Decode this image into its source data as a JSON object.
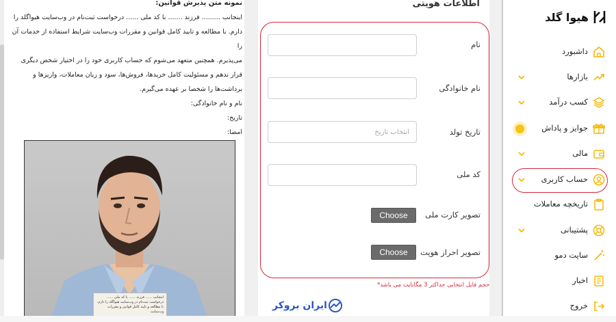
{
  "sample": {
    "title": "نمونه متن پذیرش قوانین:",
    "line1": "اینجانب ......... فرزند ....... با کد ملی ...... درخواست ثبت‌نام در وب‌سایت هیواگلد را",
    "line2": "دارم. با مطالعه و تایید کامل قوانین و مقررات وب‌سایت شرایط استفاده از خدمات آن را",
    "line3": "می‌پذیرم. همچنین متعهد می‌شوم که حساب کاربری خود را در اختیار شخص دیگری",
    "line4": "قرار ندهم و مسئولیت کامل خریدها، فروش‌ها، سود و زیان معاملات، واریزها و",
    "line5": "برداشت‌ها را شخصا بر عهده می‌گیرم.",
    "name_line": "نام و نام خانوادگی:",
    "date_line": "تاریخ:",
    "sign_line": "امضا:",
    "photo_note": "اینجانب ...... فرزند ...... با کد ملی ...... درخواست ثبت‌نام در وب‌سایت هیواگلد را دارم. با مطالعه و تایید کامل قوانین و مقررات وب‌سایت"
  },
  "form": {
    "heading": "اطلاعات هویتی",
    "first_name_label": "نام",
    "first_name_value": "",
    "last_name_label": "نام خانوادگی",
    "last_name_value": "",
    "birth_date_label": "تاریخ تولد",
    "birth_date_placeholder": "انتخاب تاریخ",
    "national_code_label": "کد ملی",
    "national_code_value": "",
    "id_card_label": "تصویر کارت ملی",
    "identity_photo_label": "تصویر احراز هویت",
    "choose_file_label": "Choose File",
    "file_size_note": "*حجم فایل انتخابی حداکثر 3 مگابایت می باشد*"
  },
  "brand": {
    "name": "ایران بروکر"
  },
  "app": {
    "name": "هیوا گلد"
  },
  "sidebar": {
    "items": [
      {
        "label": "داشبورد",
        "icon": "home-icon",
        "has_chevron": false
      },
      {
        "label": "بازارها",
        "icon": "trend-icon",
        "has_chevron": true
      },
      {
        "label": "کسب درآمد",
        "icon": "layers-icon",
        "has_chevron": true
      },
      {
        "label": "جوایز و پاداش",
        "icon": "gift-icon",
        "has_chevron": false
      },
      {
        "label": "مالی",
        "icon": "wallet-icon",
        "has_chevron": true
      },
      {
        "label": "حساب کاربری",
        "icon": "user-circle-icon",
        "has_chevron": true
      },
      {
        "label": "تاریخچه معاملات",
        "icon": "clipboard-icon",
        "has_chevron": false
      },
      {
        "label": "پشتیبانی",
        "icon": "lifebuoy-icon",
        "has_chevron": true
      },
      {
        "label": "سایت دمو",
        "icon": "magic-wand-icon",
        "has_chevron": false
      },
      {
        "label": "اخبار",
        "icon": "news-icon",
        "has_chevron": false
      },
      {
        "label": "خروج",
        "icon": "logout-icon",
        "has_chevron": false
      }
    ]
  },
  "colors": {
    "accent": "#f5b800",
    "highlight": "#d6263b",
    "brand_blue": "#2c56c6"
  }
}
